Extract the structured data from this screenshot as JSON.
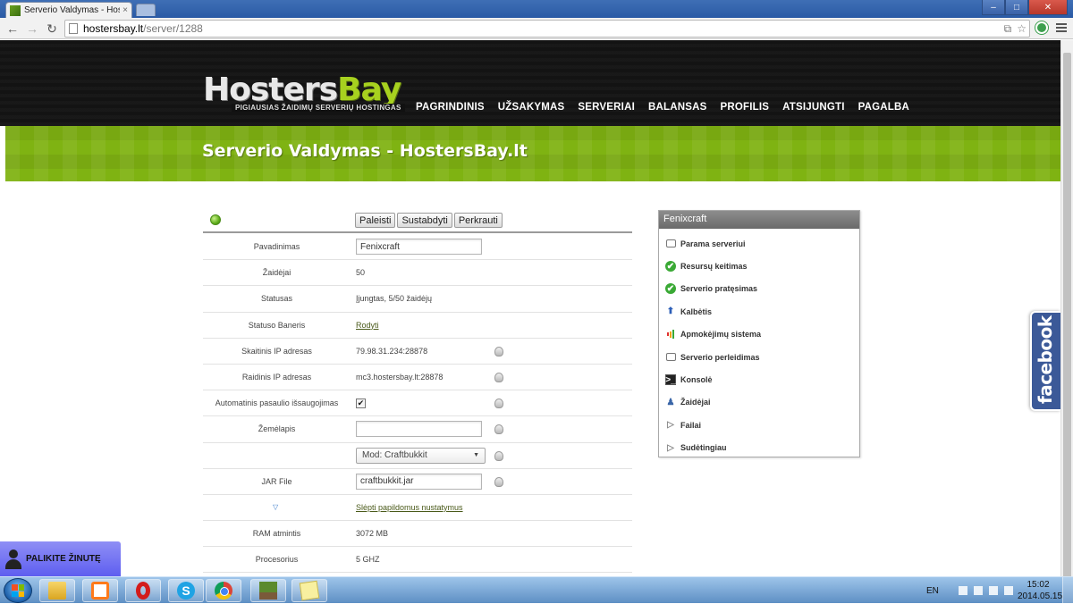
{
  "browser": {
    "tab_title": "Serverio Valdymas - Hoste",
    "tab_close": "×",
    "url_host": "hostersbay.lt",
    "url_path": "/server/1288",
    "window_buttons": {
      "minimize": "–",
      "maximize": "□",
      "close": "✕"
    }
  },
  "site": {
    "logo_hosters": "Hosters",
    "logo_bay": "Bay",
    "logo_tagline": "PIGIAUSIAS ŽAIDIMŲ SERVERIŲ HOSTINGAS",
    "nav": [
      "PAGRINDINIS",
      "UŽSAKYMAS",
      "SERVERIAI",
      "BALANSAS",
      "PROFILIS",
      "ATSIJUNGTI",
      "PAGALBA"
    ],
    "page_title": "Serverio Valdymas - HostersBay.lt"
  },
  "server": {
    "controls": [
      "Paleisti",
      "Sustabdyti",
      "Perkrauti"
    ],
    "rows": [
      {
        "label": "Pavadinimas",
        "value": "Fenixcraft"
      },
      {
        "label": "Žaidėjai",
        "value": "50"
      },
      {
        "label": "Statusas",
        "value": "Įjungtas, 5/50 žaidėjų"
      },
      {
        "label": "Statuso Baneris",
        "value": "Rodyti"
      },
      {
        "label": "Skaitinis IP adresas",
        "value": "79.98.31.234:28878"
      },
      {
        "label": "Raidinis IP adresas",
        "value": "mc3.hostersbay.lt:28878"
      },
      {
        "label": "Automatinis pasaulio išsaugojimas",
        "value": "✔"
      },
      {
        "label": "Žemėlapis",
        "value": ""
      },
      {
        "label": "",
        "value": "Mod: Craftbukkit"
      },
      {
        "label": "JAR File",
        "value": "craftbukkit.jar"
      },
      {
        "label": "▽",
        "value": "Slėpti papildomus nustatymus"
      },
      {
        "label": "RAM atmintis",
        "value": "3072 MB"
      },
      {
        "label": "Procesorius",
        "value": "5 GHZ"
      }
    ],
    "select_arrow": "▼"
  },
  "side_menu": {
    "title": "Fenixcraft",
    "items": [
      {
        "label": "Parama serveriui",
        "icon": "chat-bubble-icon"
      },
      {
        "label": "Resursų keitimas",
        "icon": "check-icon"
      },
      {
        "label": "Serverio pratęsimas",
        "icon": "check-icon"
      },
      {
        "label": "Kalbėtis",
        "icon": "arrow-up-icon"
      },
      {
        "label": "Apmokėjimų sistema",
        "icon": "bars-icon"
      },
      {
        "label": "Serverio perleidimas",
        "icon": "chat-bubble-icon"
      },
      {
        "label": "Konsolė",
        "icon": "console-icon"
      },
      {
        "label": "Žaidėjai",
        "icon": "user-icon"
      },
      {
        "label": "Failai",
        "icon": "triangle-right-icon"
      },
      {
        "label": "Sudėtingiau",
        "icon": "triangle-right-icon"
      }
    ],
    "check_glyph": "✔",
    "arrow_glyph": "⬆",
    "console_glyph": ">_",
    "user_glyph": "♟",
    "tri_glyph": "▷"
  },
  "facebook_label": "facebook",
  "message_button": "PALIKITE ŽINUTĘ",
  "taskbar": {
    "language": "EN",
    "time": "15:02",
    "date": "2014.05.15"
  },
  "colors": {
    "accent_green": "#7fb312",
    "facebook_blue": "#3b5998",
    "message_purple": "#6b6bf2"
  }
}
